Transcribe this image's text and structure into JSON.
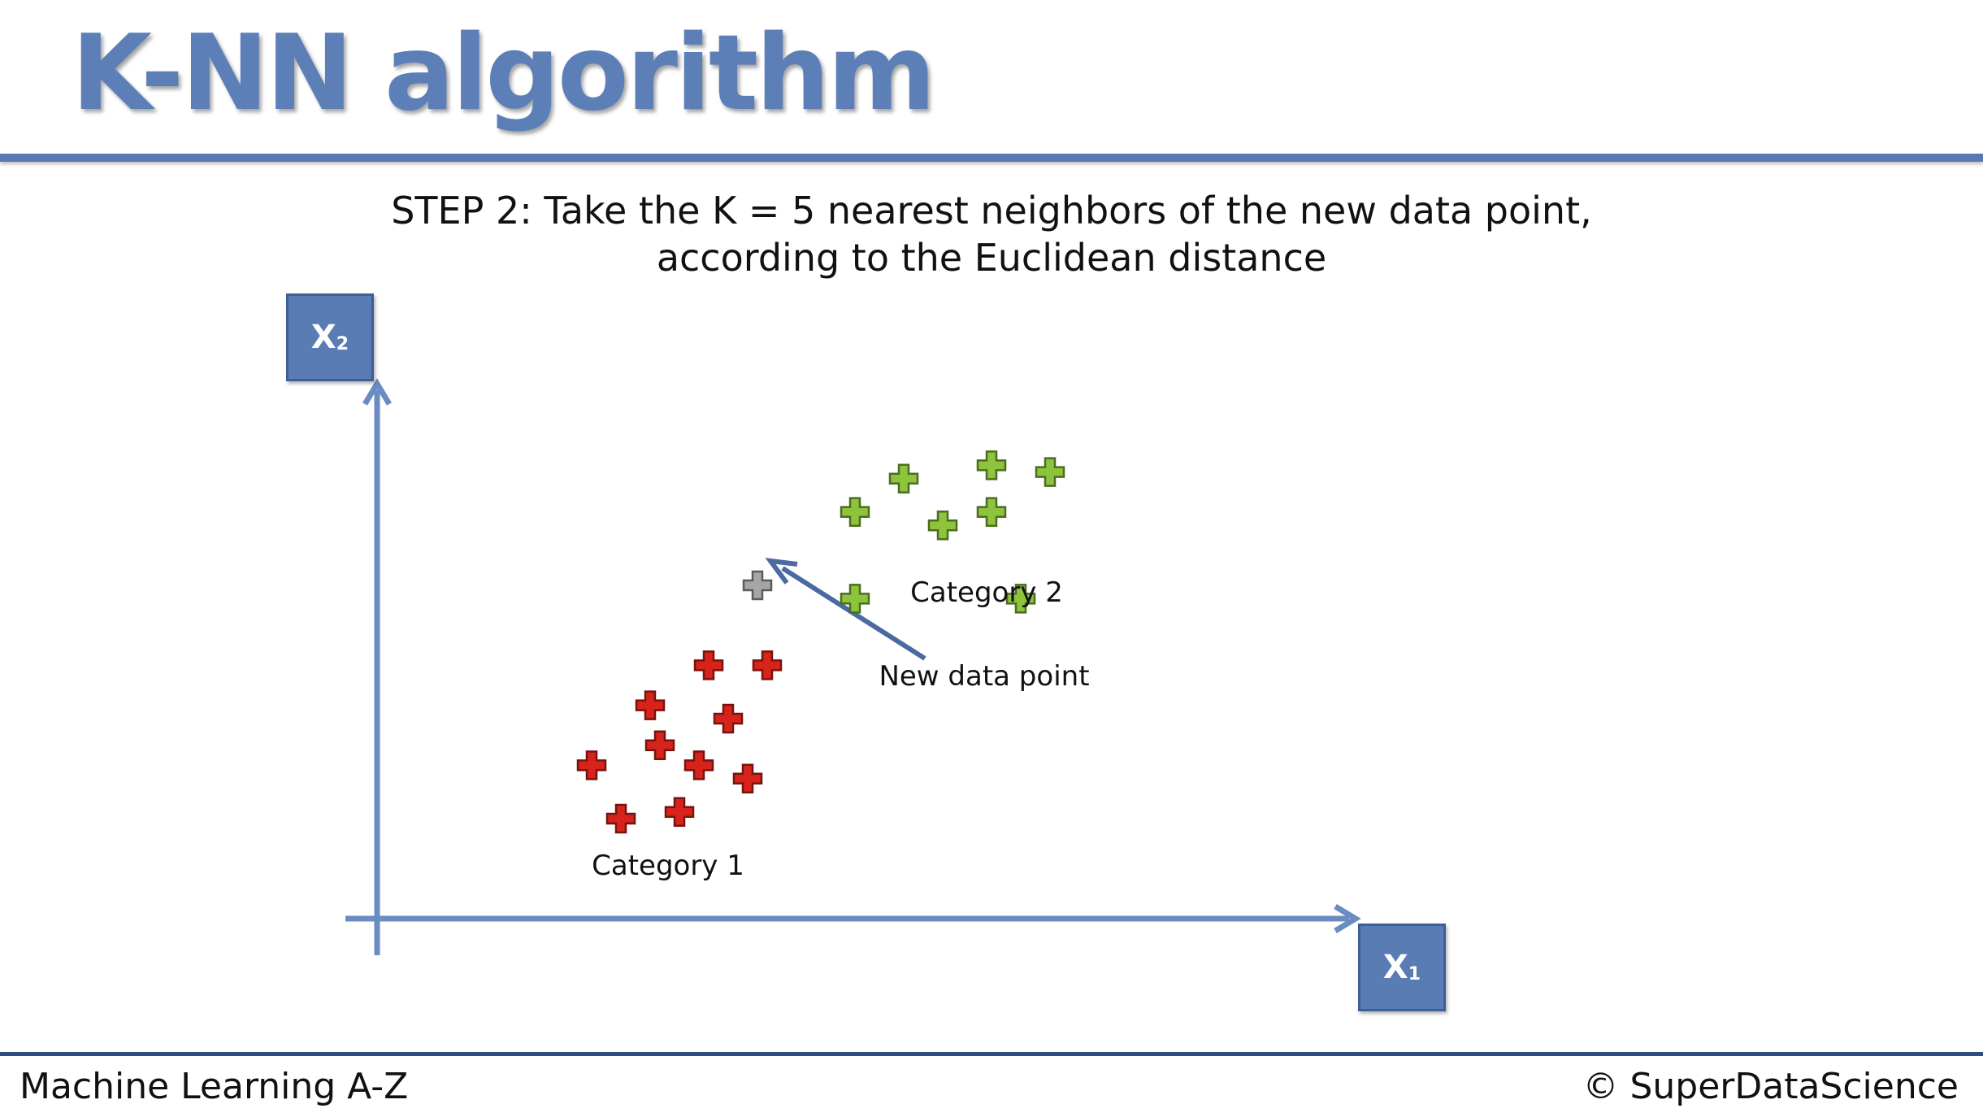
{
  "header": {
    "title": "K-NN algorithm"
  },
  "instruction": {
    "step_label": "STEP 2",
    "line1_text": ": Take the K = 5 nearest neighbors of the new data point,",
    "line2_text": "according to the Euclidean distance"
  },
  "axes": {
    "x_label": "X",
    "x_sub": "1",
    "y_label": "X",
    "y_sub": "2"
  },
  "chart_data": {
    "type": "scatter",
    "grid": false,
    "series": [
      {
        "name": "Category 1",
        "color": "#d8231b",
        "points": [
          [
            3.4,
            3.8
          ],
          [
            4.0,
            3.8
          ],
          [
            2.8,
            3.2
          ],
          [
            3.6,
            3.0
          ],
          [
            2.9,
            2.6
          ],
          [
            2.2,
            2.3
          ],
          [
            3.3,
            2.3
          ],
          [
            3.8,
            2.1
          ],
          [
            2.5,
            1.5
          ],
          [
            3.1,
            1.6
          ]
        ]
      },
      {
        "name": "Category 2",
        "color": "#8cc43c",
        "points": [
          [
            4.9,
            6.1
          ],
          [
            5.4,
            6.6
          ],
          [
            6.3,
            6.8
          ],
          [
            6.9,
            6.7
          ],
          [
            5.8,
            5.9
          ],
          [
            6.3,
            6.1
          ],
          [
            4.9,
            4.8
          ],
          [
            6.6,
            4.8
          ]
        ]
      },
      {
        "name": "New data point",
        "color": "#a6a6a6",
        "points": [
          [
            3.9,
            5.0
          ]
        ]
      }
    ],
    "annotations": [
      "Category 1",
      "Category 2",
      "New data point"
    ]
  },
  "footer": {
    "left": "Machine Learning A-Z",
    "right": "© SuperDataScience"
  }
}
